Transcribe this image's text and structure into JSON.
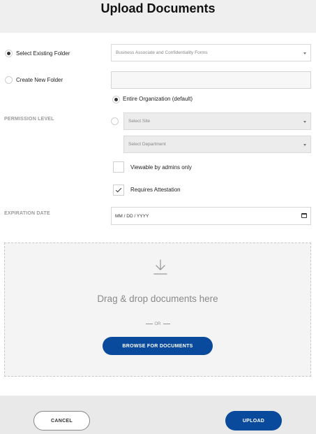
{
  "dialog": {
    "title": "Upload Documents"
  },
  "folder": {
    "select_existing_label": "Select Existing Folder",
    "existing_folder_value": "Business Associate and Confidentiality Forms",
    "create_new_label": "Create New Folder",
    "new_folder_value": ""
  },
  "permission": {
    "section_label": "PERMISSION LEVEL",
    "entire_org_label": "Entire Organization (default)",
    "site_placeholder": "Select Site",
    "department_placeholder": "Select Department",
    "admins_only_label": "Viewable by admins only",
    "attestation_label": "Requires Attestation"
  },
  "expiration": {
    "section_label": "EXPIRATION DATE",
    "date_placeholder": "MM / DD / YYYY"
  },
  "dropzone": {
    "main_text": "Drag & drop documents here",
    "or_text": "OR",
    "browse_label": "BROWSE FOR DOCUMENTS"
  },
  "footer": {
    "cancel_label": "CANCEL",
    "upload_label": "UPLOAD"
  },
  "colors": {
    "primary": "#0a4a9c"
  },
  "icons": [
    "caret-down-icon",
    "calendar-icon",
    "download-icon",
    "checkmark-icon"
  ]
}
